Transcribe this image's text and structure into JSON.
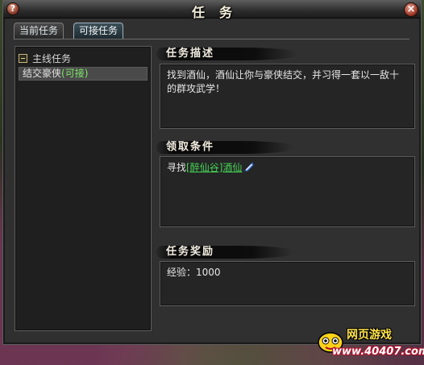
{
  "window": {
    "title": "任务",
    "help_label": "?",
    "close_label": "×"
  },
  "tabs": [
    {
      "label": "当前任务",
      "active": false
    },
    {
      "label": "可接任务",
      "active": true
    }
  ],
  "quest_list": {
    "group_label": "主线任务",
    "quests": [
      {
        "name": "结交豪侠",
        "status": "(可接)",
        "selected": true
      }
    ]
  },
  "sections": {
    "description": {
      "title": "任务描述",
      "text": "找到酒仙，酒仙让你与豪侠结交，并习得一套以一敌十的群攻武学！"
    },
    "requirement": {
      "title": "领取条件",
      "prefix": "寻找",
      "npc_link": "[醉仙谷]酒仙",
      "npc_icon": "teleport-feather-icon"
    },
    "reward": {
      "title": "任务奖励",
      "text": "经验：1000"
    }
  },
  "watermark": {
    "top": "网页游戏",
    "bottom": "www.40407.com"
  },
  "colors": {
    "accent_green": "#45d456",
    "status_green": "#7fe86a"
  }
}
